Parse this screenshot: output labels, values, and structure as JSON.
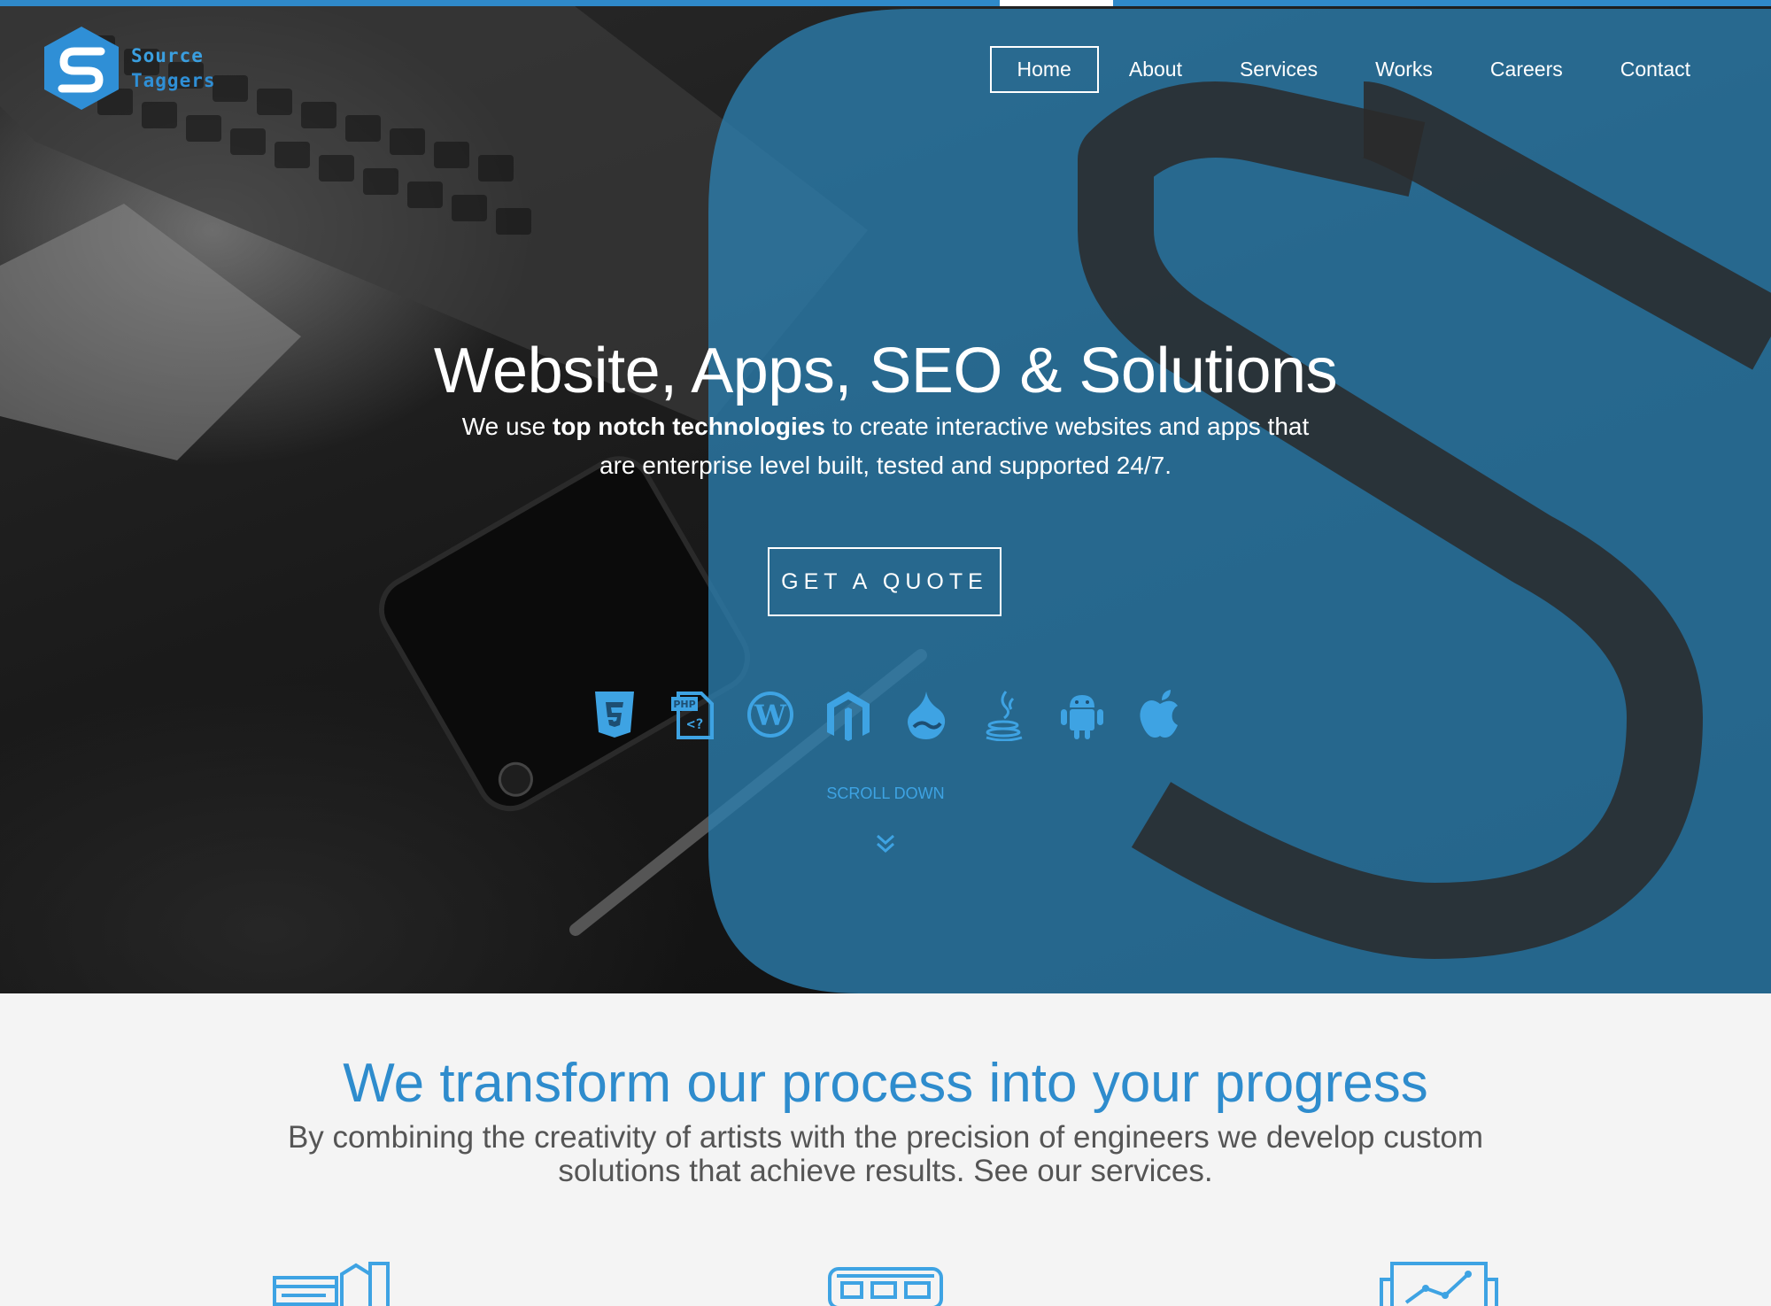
{
  "brand": {
    "line1": "Source",
    "line2": "Taggers",
    "color": "#2f8fd6"
  },
  "nav": {
    "items": [
      {
        "label": "Home",
        "active": true
      },
      {
        "label": "About",
        "active": false
      },
      {
        "label": "Services",
        "active": false
      },
      {
        "label": "Works",
        "active": false
      },
      {
        "label": "Careers",
        "active": false
      },
      {
        "label": "Contact",
        "active": false
      }
    ]
  },
  "hero": {
    "title": "Website, Apps, SEO & Solutions",
    "sub_before": "We use ",
    "sub_bold": "top notch technologies",
    "sub_after": " to create interactive websites and apps that are enterprise level built, tested and supported 24/7.",
    "cta": "GET A QUOTE",
    "tech_icons": [
      "html5-icon",
      "php-icon",
      "wordpress-icon",
      "magento-icon",
      "drupal-icon",
      "java-icon",
      "android-icon",
      "apple-icon"
    ],
    "scroll_label": "SCROLL DOWN"
  },
  "section": {
    "title": "We transform our process into your progress",
    "subtitle": "By combining the creativity of artists with the precision of engineers we develop custom solutions that achieve results. See our services."
  },
  "services": {
    "icons": [
      "web-development-icon",
      "web-design-icon",
      "seo-analytics-icon"
    ]
  },
  "colors": {
    "accent": "#2f89c9",
    "overlay": "#2b7fb0",
    "icon": "#3ea3e3",
    "text_light": "#ffffff"
  }
}
